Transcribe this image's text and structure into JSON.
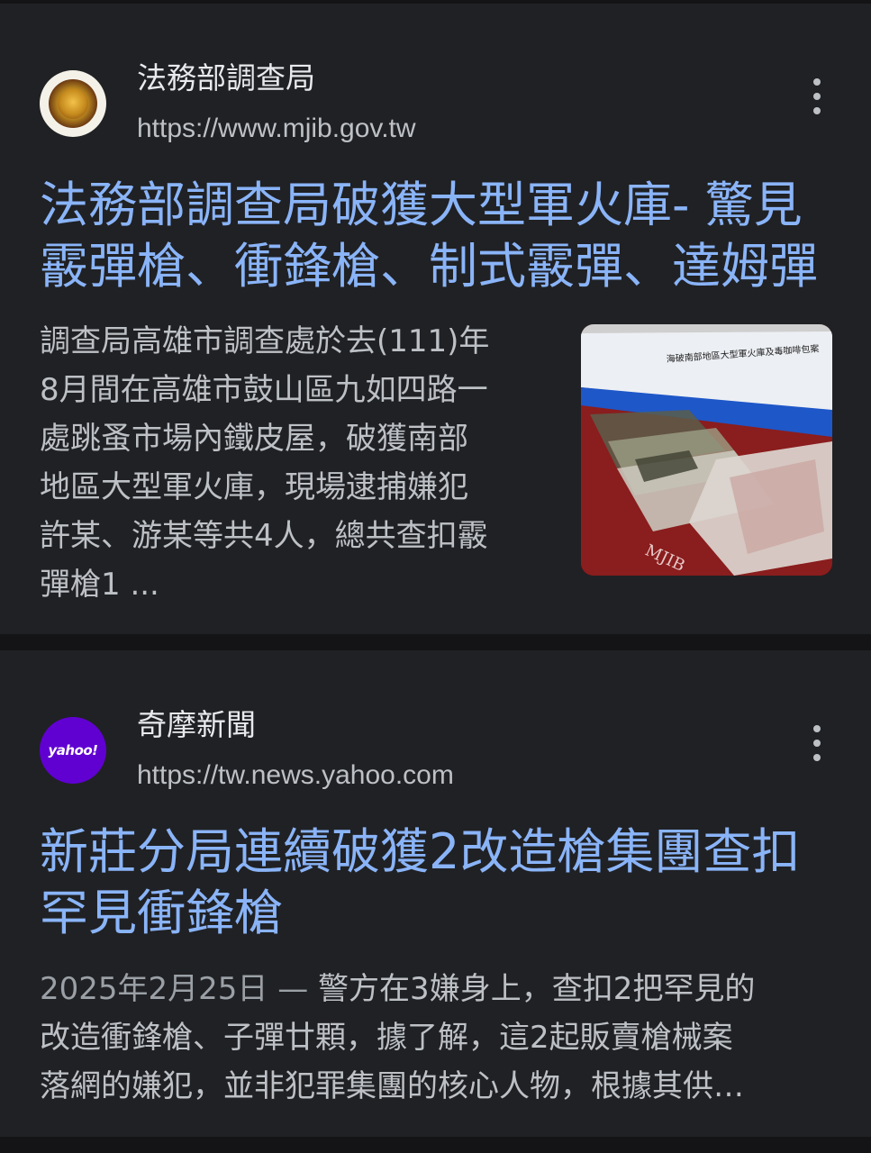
{
  "results": [
    {
      "source_name": "法務部調查局",
      "source_url": "https://www.mjib.gov.tw",
      "favicon": "mjib-seal-icon",
      "title_lines": [
        "法務部調查局破獲大型軍火庫- 驚見",
        "霰彈槍、衝鋒槍、制式霰彈、達姆彈"
      ],
      "snippet_lines": [
        "調查局高雄市調查處於去(111)年",
        "8月間在高雄市鼓山區九如四路一",
        "處跳蚤市場內鐵皮屋，破獲南部",
        "地區大型軍火庫，現場逮捕嫌犯",
        "許某、游某等共4人，總共查扣霰",
        "彈槍1 ..."
      ],
      "thumbnail": "seized-weapons-press-photo",
      "thumbnail_banner_text": "海破南部地區大型軍火庫及毒咖啡包案",
      "thumbnail_cloth_text": "MJIB"
    },
    {
      "source_name": "奇摩新聞",
      "source_url": "https://tw.news.yahoo.com",
      "favicon_text": "yahoo!",
      "favicon": "yahoo-logo-icon",
      "title_lines": [
        "新莊分局連續破獲2改造槍集團查扣",
        "罕見衝鋒槍"
      ],
      "date": "2025年2月25日",
      "date_separator": "—",
      "snippet_first": "警方在3嫌身上，查扣2把罕見的",
      "snippet_lines": [
        "改造衝鋒槍、子彈廿顆，據了解，這2起販賣槍械案",
        "落網的嫌犯，並非犯罪集團的核心人物，根據其供…"
      ]
    }
  ],
  "colors": {
    "background": "#202124",
    "title_link": "#8ab4f8",
    "text": "#bdc1c6",
    "yahoo_purple": "#6001d2"
  }
}
